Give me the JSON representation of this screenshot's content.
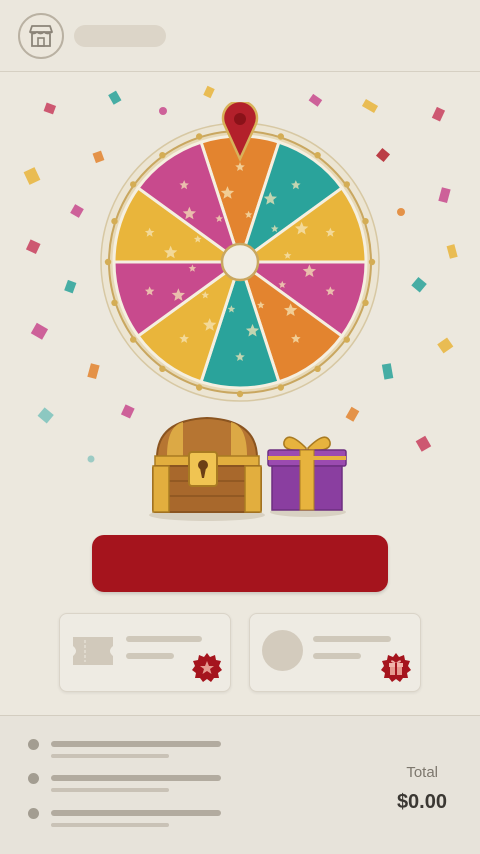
{
  "header": {
    "store_icon": "storefront-icon"
  },
  "wheel": {
    "segment_count": 10,
    "colors": [
      "#c84a8d",
      "#e3842f",
      "#2aa39b",
      "#e9b53b"
    ],
    "pointer_color": "#b3202b",
    "rim_color": "#e5d7b6",
    "hub_color": "#f1ede2"
  },
  "prizes": {
    "chest_icon": "treasure-chest-icon",
    "gift_icon": "gift-box-icon"
  },
  "spin_button": {
    "color": "#a5141d"
  },
  "reward_cards": [
    {
      "thumb": "ticket-icon",
      "badge": "star-badge-icon"
    },
    {
      "thumb": "avatar-placeholder",
      "badge": "gift-badge-icon"
    }
  ],
  "footer": {
    "total_label": "Total",
    "total_value": "$0.00",
    "line_item_count": 3
  }
}
